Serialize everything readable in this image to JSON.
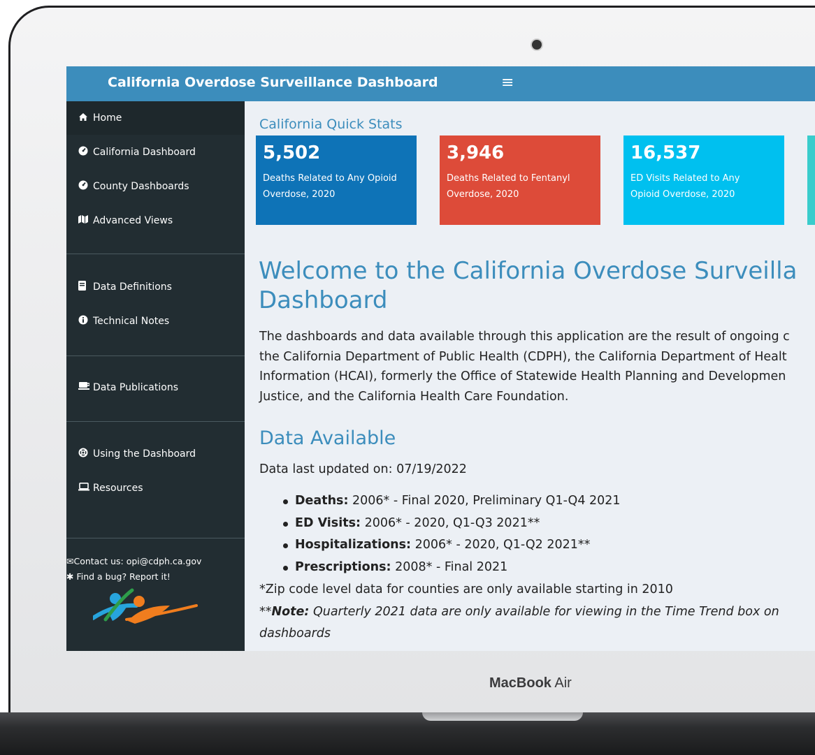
{
  "header": {
    "app_title": "California Overdose Surveillance Dashboard",
    "menu_icon": "hamburger-icon"
  },
  "sidebar": {
    "items": [
      {
        "label": "Home",
        "icon": "home-icon"
      },
      {
        "label": "California Dashboard",
        "icon": "dashboard-icon"
      },
      {
        "label": "County Dashboards",
        "icon": "dashboard-icon"
      },
      {
        "label": "Advanced Views",
        "icon": "map-icon"
      },
      {
        "label": "Data Definitions",
        "icon": "book-icon"
      },
      {
        "label": "Technical Notes",
        "icon": "info-icon"
      },
      {
        "label": "Data Publications",
        "icon": "desk-icon"
      },
      {
        "label": "Using the Dashboard",
        "icon": "life-ring-icon"
      },
      {
        "label": "Resources",
        "icon": "laptop-icon"
      }
    ],
    "contact": "Contact us: opi@cdph.ca.gov",
    "bug": "Find a bug? Report it!"
  },
  "quick_stats": {
    "title": "California Quick Stats",
    "boxes": [
      {
        "value": "5,502",
        "label_line1": "Deaths Related to Any Opioid",
        "label_line2": "Overdose, 2020",
        "color": "#0e73b7"
      },
      {
        "value": "3,946",
        "label_line1": "Deaths Related to Fentanyl",
        "label_line2": "Overdose, 2020",
        "color": "#dd4b39"
      },
      {
        "value": "16,537",
        "label_line1": "ED Visits Related to Any",
        "label_line2": "Opioid Overdose, 2020",
        "color": "#00c0ef"
      }
    ]
  },
  "welcome": {
    "title_line1": "Welcome to the California Overdose Surveilla",
    "title_line2": "Dashboard",
    "intro_line1": "The dashboards and data available through this application are the result of ongoing c",
    "intro_line2": "the California Department of Public Health (CDPH), the California Department of Healt",
    "intro_line3": "Information (HCAI), formerly the Office of Statewide Health Planning and Developmen",
    "intro_line4": "Justice, and the California Health Care Foundation."
  },
  "data_available": {
    "title": "Data Available",
    "updated": "Data last updated on: 07/19/2022",
    "items": [
      {
        "label": "Deaths:",
        "text": " 2006* - Final 2020, Preliminary Q1-Q4 2021"
      },
      {
        "label": "ED Visits:",
        "text": " 2006* - 2020, Q1-Q3 2021**"
      },
      {
        "label": "Hospitalizations:",
        "text": " 2006* - 2020, Q1-Q2 2021**"
      },
      {
        "label": "Prescriptions:",
        "text": " 2008* - Final 2021"
      }
    ],
    "zip_note": "*Zip code level data for counties are only available starting in 2010",
    "note_prefix": "**",
    "note_label": "Note:",
    "note_text": " Quarterly 2021 data are only available for viewing in the Time Trend box on",
    "note_text2": "dashboards"
  },
  "device": {
    "label_bold": "MacBook",
    "label_light": " Air"
  }
}
